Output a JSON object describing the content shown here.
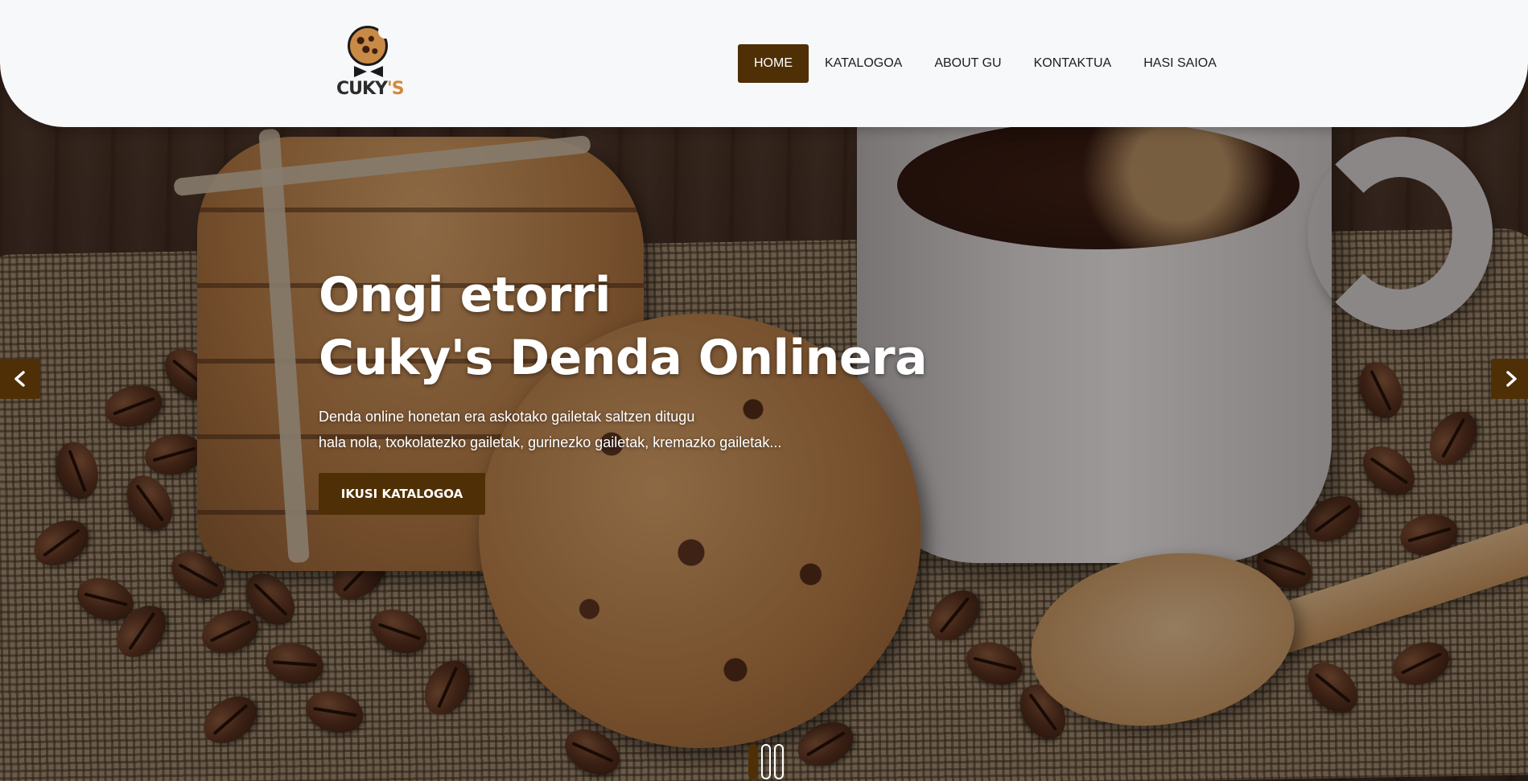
{
  "brand": {
    "logo_text_main": "CUKY",
    "logo_text_accent": "'S",
    "accent_color": "#4f2f06"
  },
  "nav": {
    "items": [
      {
        "label": "HOME",
        "active": true
      },
      {
        "label": "KATALOGOA",
        "active": false
      },
      {
        "label": "ABOUT GU",
        "active": false
      },
      {
        "label": "KONTAKTUA",
        "active": false
      },
      {
        "label": "HASI SAIOA",
        "active": false
      }
    ]
  },
  "hero": {
    "title_line1": "Ongi etorri",
    "title_line2": "Cuky's Denda Onlinera",
    "subtitle_line1": "Denda online honetan era askotako gailetak saltzen ditugu",
    "subtitle_line2": "hala nola, txokolatezko gailetak, gurinezko gailetak, kremazko gailetak...",
    "cta_label": "IKUSI KATALOGOA"
  },
  "carousel": {
    "prev_icon": "chevron-left-icon",
    "next_icon": "chevron-right-icon",
    "slide_count": 3,
    "active_slide": 1
  }
}
